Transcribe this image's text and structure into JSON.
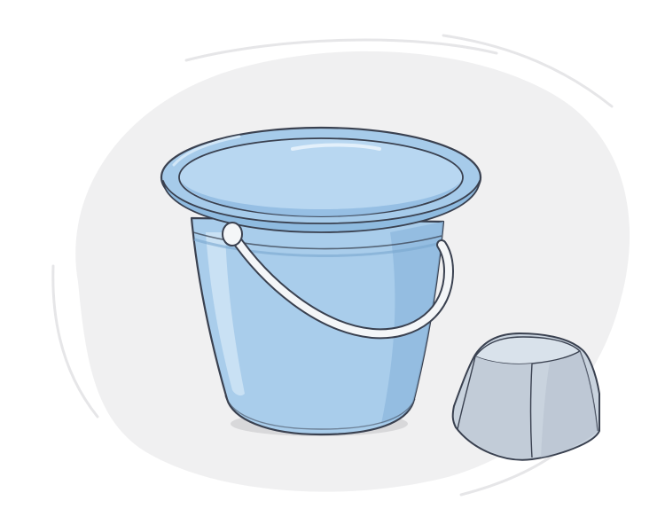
{
  "scene": {
    "objects": [
      "bucket-icon",
      "sand-mold-icon"
    ],
    "colors": {
      "background": "#ffffff",
      "blob": "#f0f0f1",
      "bucket_fill": "#a9cdeb",
      "bucket_light": "#c3ddf3",
      "bucket_dark": "#7aa7cf",
      "outline": "#3a4150",
      "handle": "#f4f6f8",
      "mold_fill": "#c9d3de",
      "mold_top": "#d7e0ea",
      "shadow": "#dcdcdd"
    }
  }
}
